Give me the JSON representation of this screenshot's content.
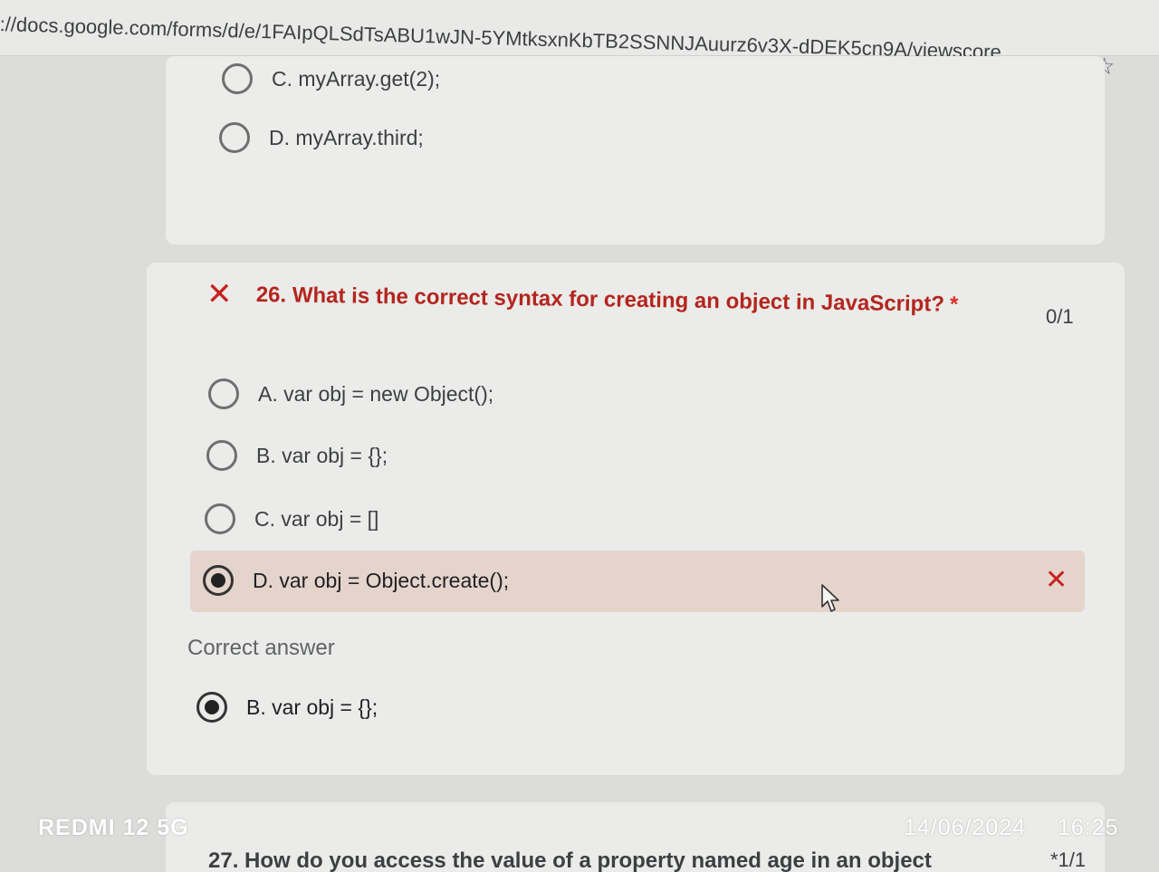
{
  "browser": {
    "url": "://docs.google.com/forms/d/e/1FAIpQLSdTsABU1wJN-5YMtksxnKbTB2SSNNJAuurz6v3X-dDEK5cn9A/viewscore...",
    "read_aloud_icon": "A¹",
    "star_icon": "☆"
  },
  "previous_question": {
    "options": [
      {
        "label": "C. myArray.get(2);",
        "selected": false
      },
      {
        "label": "D. myArray.third;",
        "selected": false
      }
    ]
  },
  "question": {
    "number_title": "26. What is the correct syntax for creating an object in JavaScript?",
    "required_mark": "*",
    "score": "0/1",
    "status": "incorrect",
    "options": [
      {
        "label": "A. var obj = new Object();",
        "selected": false
      },
      {
        "label": "B. var obj = {};",
        "selected": false
      },
      {
        "label": "C. var obj = []",
        "selected": false
      },
      {
        "label": "D. var obj = Object.create();",
        "selected": true
      }
    ],
    "correct_answer_label": "Correct answer",
    "correct_answer": "B. var obj = {};"
  },
  "next_question": {
    "partial_title": "27. How do you access the value of a property named age in an object",
    "score": "*1/1"
  },
  "watermark": {
    "device": "REDMI 12 5G",
    "date": "14/06/2024",
    "time": "16:25"
  },
  "colors": {
    "incorrect": "#c5221f",
    "selected_bg": "#e5d4cc"
  }
}
